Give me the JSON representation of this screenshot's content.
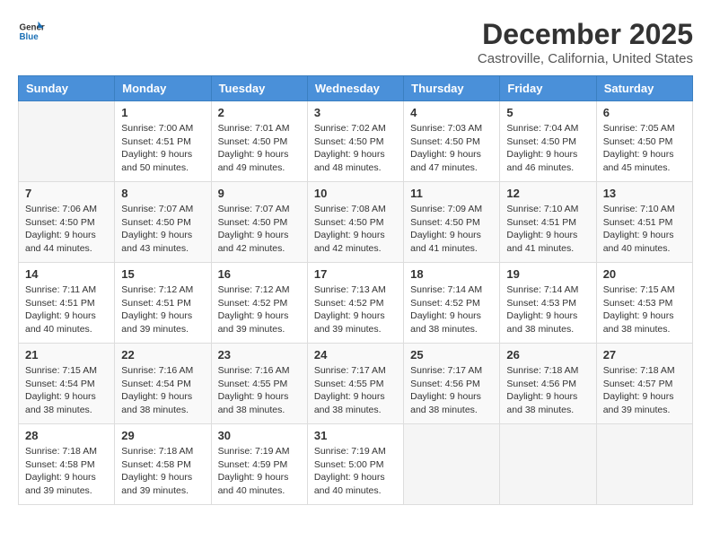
{
  "header": {
    "logo_line1": "General",
    "logo_line2": "Blue",
    "title": "December 2025",
    "subtitle": "Castroville, California, United States"
  },
  "calendar": {
    "days_of_week": [
      "Sunday",
      "Monday",
      "Tuesday",
      "Wednesday",
      "Thursday",
      "Friday",
      "Saturday"
    ],
    "weeks": [
      [
        {
          "day": "",
          "info": ""
        },
        {
          "day": "1",
          "info": "Sunrise: 7:00 AM\nSunset: 4:51 PM\nDaylight: 9 hours\nand 50 minutes."
        },
        {
          "day": "2",
          "info": "Sunrise: 7:01 AM\nSunset: 4:50 PM\nDaylight: 9 hours\nand 49 minutes."
        },
        {
          "day": "3",
          "info": "Sunrise: 7:02 AM\nSunset: 4:50 PM\nDaylight: 9 hours\nand 48 minutes."
        },
        {
          "day": "4",
          "info": "Sunrise: 7:03 AM\nSunset: 4:50 PM\nDaylight: 9 hours\nand 47 minutes."
        },
        {
          "day": "5",
          "info": "Sunrise: 7:04 AM\nSunset: 4:50 PM\nDaylight: 9 hours\nand 46 minutes."
        },
        {
          "day": "6",
          "info": "Sunrise: 7:05 AM\nSunset: 4:50 PM\nDaylight: 9 hours\nand 45 minutes."
        }
      ],
      [
        {
          "day": "7",
          "info": "Sunrise: 7:06 AM\nSunset: 4:50 PM\nDaylight: 9 hours\nand 44 minutes."
        },
        {
          "day": "8",
          "info": "Sunrise: 7:07 AM\nSunset: 4:50 PM\nDaylight: 9 hours\nand 43 minutes."
        },
        {
          "day": "9",
          "info": "Sunrise: 7:07 AM\nSunset: 4:50 PM\nDaylight: 9 hours\nand 42 minutes."
        },
        {
          "day": "10",
          "info": "Sunrise: 7:08 AM\nSunset: 4:50 PM\nDaylight: 9 hours\nand 42 minutes."
        },
        {
          "day": "11",
          "info": "Sunrise: 7:09 AM\nSunset: 4:50 PM\nDaylight: 9 hours\nand 41 minutes."
        },
        {
          "day": "12",
          "info": "Sunrise: 7:10 AM\nSunset: 4:51 PM\nDaylight: 9 hours\nand 41 minutes."
        },
        {
          "day": "13",
          "info": "Sunrise: 7:10 AM\nSunset: 4:51 PM\nDaylight: 9 hours\nand 40 minutes."
        }
      ],
      [
        {
          "day": "14",
          "info": "Sunrise: 7:11 AM\nSunset: 4:51 PM\nDaylight: 9 hours\nand 40 minutes."
        },
        {
          "day": "15",
          "info": "Sunrise: 7:12 AM\nSunset: 4:51 PM\nDaylight: 9 hours\nand 39 minutes."
        },
        {
          "day": "16",
          "info": "Sunrise: 7:12 AM\nSunset: 4:52 PM\nDaylight: 9 hours\nand 39 minutes."
        },
        {
          "day": "17",
          "info": "Sunrise: 7:13 AM\nSunset: 4:52 PM\nDaylight: 9 hours\nand 39 minutes."
        },
        {
          "day": "18",
          "info": "Sunrise: 7:14 AM\nSunset: 4:52 PM\nDaylight: 9 hours\nand 38 minutes."
        },
        {
          "day": "19",
          "info": "Sunrise: 7:14 AM\nSunset: 4:53 PM\nDaylight: 9 hours\nand 38 minutes."
        },
        {
          "day": "20",
          "info": "Sunrise: 7:15 AM\nSunset: 4:53 PM\nDaylight: 9 hours\nand 38 minutes."
        }
      ],
      [
        {
          "day": "21",
          "info": "Sunrise: 7:15 AM\nSunset: 4:54 PM\nDaylight: 9 hours\nand 38 minutes."
        },
        {
          "day": "22",
          "info": "Sunrise: 7:16 AM\nSunset: 4:54 PM\nDaylight: 9 hours\nand 38 minutes."
        },
        {
          "day": "23",
          "info": "Sunrise: 7:16 AM\nSunset: 4:55 PM\nDaylight: 9 hours\nand 38 minutes."
        },
        {
          "day": "24",
          "info": "Sunrise: 7:17 AM\nSunset: 4:55 PM\nDaylight: 9 hours\nand 38 minutes."
        },
        {
          "day": "25",
          "info": "Sunrise: 7:17 AM\nSunset: 4:56 PM\nDaylight: 9 hours\nand 38 minutes."
        },
        {
          "day": "26",
          "info": "Sunrise: 7:18 AM\nSunset: 4:56 PM\nDaylight: 9 hours\nand 38 minutes."
        },
        {
          "day": "27",
          "info": "Sunrise: 7:18 AM\nSunset: 4:57 PM\nDaylight: 9 hours\nand 39 minutes."
        }
      ],
      [
        {
          "day": "28",
          "info": "Sunrise: 7:18 AM\nSunset: 4:58 PM\nDaylight: 9 hours\nand 39 minutes."
        },
        {
          "day": "29",
          "info": "Sunrise: 7:18 AM\nSunset: 4:58 PM\nDaylight: 9 hours\nand 39 minutes."
        },
        {
          "day": "30",
          "info": "Sunrise: 7:19 AM\nSunset: 4:59 PM\nDaylight: 9 hours\nand 40 minutes."
        },
        {
          "day": "31",
          "info": "Sunrise: 7:19 AM\nSunset: 5:00 PM\nDaylight: 9 hours\nand 40 minutes."
        },
        {
          "day": "",
          "info": ""
        },
        {
          "day": "",
          "info": ""
        },
        {
          "day": "",
          "info": ""
        }
      ]
    ]
  }
}
